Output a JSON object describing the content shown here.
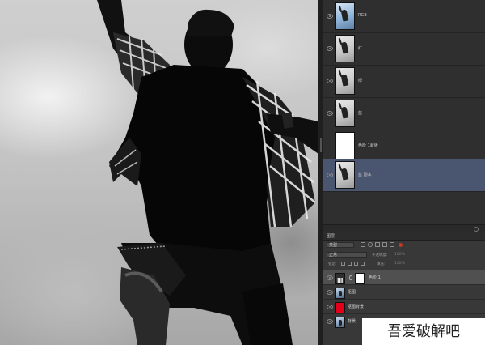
{
  "channels": {
    "rows": [
      {
        "label": "RGB",
        "thumb": "blue",
        "selected": false
      },
      {
        "label": "红",
        "thumb": "gray",
        "selected": false
      },
      {
        "label": "绿",
        "thumb": "gray",
        "selected": false
      },
      {
        "label": "蓝",
        "thumb": "gray",
        "selected": false
      },
      {
        "label": "色阶 1蒙版",
        "thumb": "white",
        "selected": false
      },
      {
        "label": "蓝 副本",
        "thumb": "gray",
        "selected": true
      }
    ]
  },
  "layers": {
    "tab_label": "图层",
    "filter_kind": "类型",
    "blend_mode": "正常",
    "opacity_label": "不透明度:",
    "opacity_value": "100%",
    "lock_label": "锁定:",
    "fill_label": "填充:",
    "fill_value": "100%",
    "items": [
      {
        "name": "色阶 1",
        "type": "adjustment",
        "selected": true
      },
      {
        "name": "抠图",
        "type": "photo",
        "selected": false
      },
      {
        "name": "抠图背景",
        "type": "red",
        "selected": false
      },
      {
        "name": "背景",
        "type": "photo",
        "selected": false
      }
    ]
  },
  "watermark": {
    "text": "吾爱破解吧"
  },
  "colors": {
    "selection": "#4a5670",
    "panel": "#2f2f2f",
    "mask_red": "#e4001b"
  }
}
